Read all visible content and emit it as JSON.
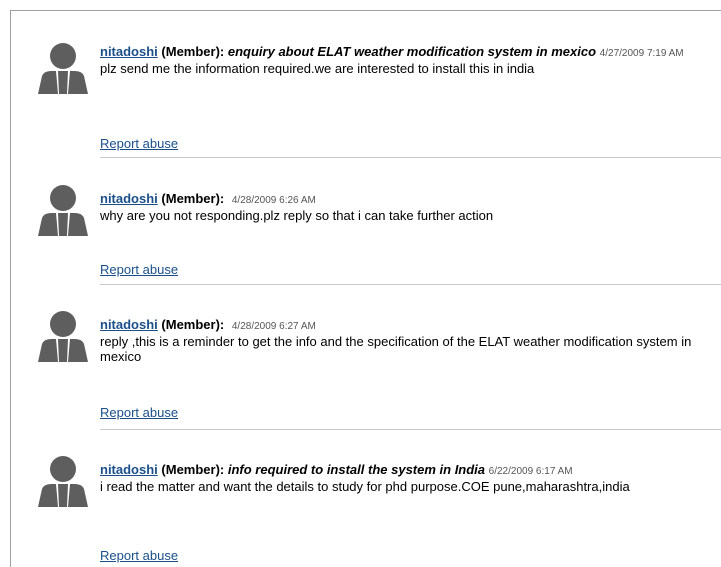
{
  "comments": [
    {
      "user": "nitadoshi",
      "role": "(Member):",
      "subject": "enquiry about ELAT weather modification system in mexico",
      "date": "4/27/2009 7:19 AM",
      "text": "plz send me the information required.we are interested to install this in india",
      "report": "Report abuse"
    },
    {
      "user": "nitadoshi",
      "role": "(Member):",
      "subject": "",
      "date": "4/28/2009 6:26 AM",
      "text": "why are you not responding.plz reply so that i can take further action",
      "report": "Report abuse"
    },
    {
      "user": "nitadoshi",
      "role": "(Member):",
      "subject": "",
      "date": "4/28/2009 6:27 AM",
      "text": "reply ,this is a reminder to get the info and the specification of the ELAT weather modification system in mexico",
      "report": "Report abuse"
    },
    {
      "user": "nitadoshi",
      "role": "(Member):",
      "subject": "info required to install the system in India",
      "date": "6/22/2009 6:17 AM",
      "text": "i read the matter and want the details to study for phd purpose.COE pune,maharashtra,india",
      "report": "Report abuse"
    }
  ],
  "icons": {
    "avatar": "user-silhouette-icon"
  },
  "colors": {
    "link": "#1a4f8a",
    "avatar": "#5e5e5e"
  }
}
